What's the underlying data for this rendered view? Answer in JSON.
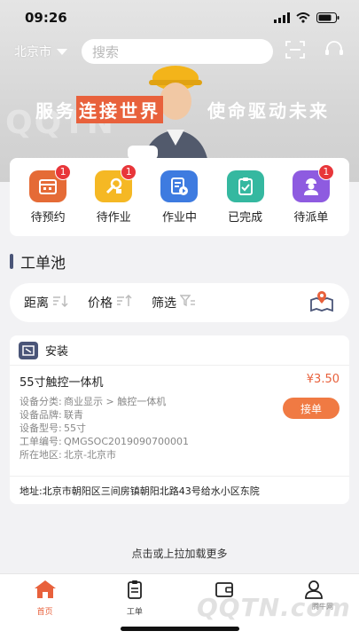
{
  "status": {
    "time": "09:26"
  },
  "header": {
    "city": "北京市",
    "search_placeholder": "搜索"
  },
  "banner": {
    "slogan_part1": "服务",
    "slogan_highlight": "连接世界",
    "slogan_part2": "使命驱动未来"
  },
  "quick": [
    {
      "label": "待预约",
      "badge": "1",
      "color": "#e56b36",
      "icon": "calendar-icon"
    },
    {
      "label": "待作业",
      "badge": "1",
      "color": "#f5b824",
      "icon": "tools-icon"
    },
    {
      "label": "作业中",
      "badge": "",
      "color": "#3e7be0",
      "icon": "document-play-icon"
    },
    {
      "label": "已完成",
      "badge": "",
      "color": "#35b8a0",
      "icon": "clipboard-check-icon"
    },
    {
      "label": "待派单",
      "badge": "1",
      "color": "#8e5be0",
      "icon": "worker-icon"
    }
  ],
  "section": {
    "title": "工单池"
  },
  "filters": [
    {
      "label": "距离"
    },
    {
      "label": "价格"
    },
    {
      "label": "筛选"
    }
  ],
  "order": {
    "type": "安装",
    "title": "55寸触控一体机",
    "price": "¥3.50",
    "lines": [
      {
        "k": "设备分类:",
        "v": "商业显示 > 触控一体机"
      },
      {
        "k": "设备品牌:",
        "v": "联青"
      },
      {
        "k": "设备型号:",
        "v": "55寸"
      },
      {
        "k": "工单编号:",
        "v": "QMGSOC2019090700001"
      },
      {
        "k": "所在地区:",
        "v": "北京-北京市"
      }
    ],
    "button": "接单",
    "address": "地址:北京市朝阳区三间房镇朝阳北路43号给水小区东院"
  },
  "load_more": "点击或上拉加载更多",
  "tabs": [
    {
      "label": "首页"
    },
    {
      "label": "工单"
    },
    {
      "label": ""
    },
    {
      "label": ""
    }
  ],
  "watermark": {
    "text": "QQTN.com",
    "small": "腾牛网"
  },
  "colors": {
    "accent": "#e8613c",
    "navy": "#4a5578",
    "button": "#f07a43",
    "badge": "#e8363a"
  }
}
